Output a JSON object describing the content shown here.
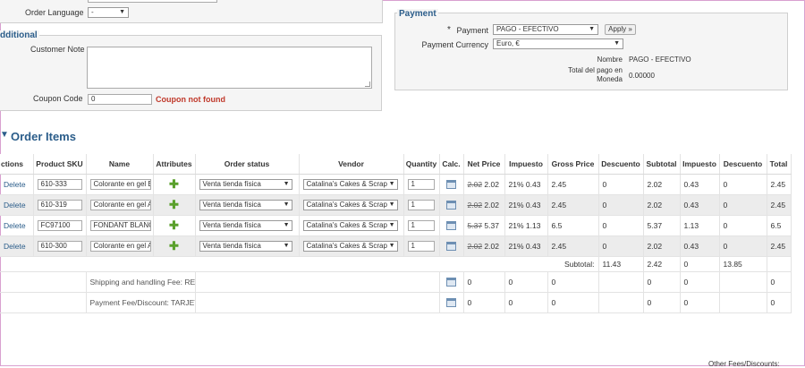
{
  "general": {
    "order_language_label": "Order Language",
    "order_language_value": "-"
  },
  "additional": {
    "legend": "dditional",
    "customer_note_label": "Customer Note",
    "customer_note_value": "",
    "coupon_label": "Coupon Code",
    "coupon_value": "0",
    "coupon_error": "Coupon not found"
  },
  "payment": {
    "legend": "Payment",
    "required_mark": "*",
    "payment_label": "Payment",
    "payment_value": "PAGO - EFECTIVO",
    "apply_label": "Apply »",
    "currency_label": "Payment Currency",
    "currency_value": "Euro, €",
    "nombre_label": "Nombre",
    "nombre_value": "PAGO - EFECTIVO",
    "total_label_1": "Total del pago en",
    "total_label_2": "Moneda",
    "total_value": "0.00000"
  },
  "order_items": {
    "title": "Order Items",
    "columns": [
      "ctions",
      "Product SKU",
      "Name",
      "Attributes",
      "Order status",
      "Vendor",
      "Quantity",
      "Calc.",
      "Net Price",
      "Impuesto",
      "Gross Price",
      "Descuento",
      "Subtotal",
      "Impuesto",
      "Descuento",
      "Total"
    ],
    "delete_label": "Delete",
    "rows": [
      {
        "sku": "610-333",
        "name": "Colorante en gel BU",
        "status": "Venta tienda física",
        "vendor": "Catalina's Cakes & Scrap",
        "qty": "1",
        "net_old": "2.02",
        "net": "2.02",
        "tax": "21% 0.43",
        "gross": "2.45",
        "disc": "0",
        "subtotal": "2.02",
        "tax2": "0.43",
        "disc2": "0",
        "total": "2.45"
      },
      {
        "sku": "610-319",
        "name": "Colorante en gel AZ",
        "status": "Venta tienda física",
        "vendor": "Catalina's Cakes & Scrap",
        "qty": "1",
        "net_old": "2.02",
        "net": "2.02",
        "tax": "21% 0.43",
        "gross": "2.45",
        "disc": "0",
        "subtotal": "2.02",
        "tax2": "0.43",
        "disc2": "0",
        "total": "2.45"
      },
      {
        "sku": "FC97100",
        "name": "FONDANT BLANCO",
        "status": "Venta tienda física",
        "vendor": "Catalina's Cakes & Scrap",
        "qty": "1",
        "net_old": "5.37",
        "net": "5.37",
        "tax": "21% 1.13",
        "gross": "6.5",
        "disc": "0",
        "subtotal": "5.37",
        "tax2": "1.13",
        "disc2": "0",
        "total": "6.5"
      },
      {
        "sku": "610-300",
        "name": "Colorante en gel ALI",
        "status": "Venta tienda física",
        "vendor": "Catalina's Cakes & Scrap",
        "qty": "1",
        "net_old": "2.02",
        "net": "2.02",
        "tax": "21% 0.43",
        "gross": "2.45",
        "disc": "0",
        "subtotal": "2.02",
        "tax2": "0.43",
        "disc2": "0",
        "total": "2.45"
      }
    ],
    "subtotal_label": "Subtotal:",
    "subtotal": {
      "subtotal": "11.43",
      "tax": "2.42",
      "disc": "0",
      "total": "13.85"
    },
    "fees": [
      {
        "label": "Shipping and handling Fee: RECOGIDA EN TIENDA FÍSICA",
        "net": "0",
        "tax": "0",
        "gross": "0",
        "subtotal": "0",
        "tax2": "0",
        "total": "0"
      },
      {
        "label": "Payment Fee/Discount: TARJETA DE CRÉDITO",
        "net": "0",
        "tax": "0",
        "gross": "0",
        "subtotal": "0",
        "tax2": "0",
        "total": "0"
      }
    ],
    "other_fees_label": "Other Fees/Discounts:"
  }
}
